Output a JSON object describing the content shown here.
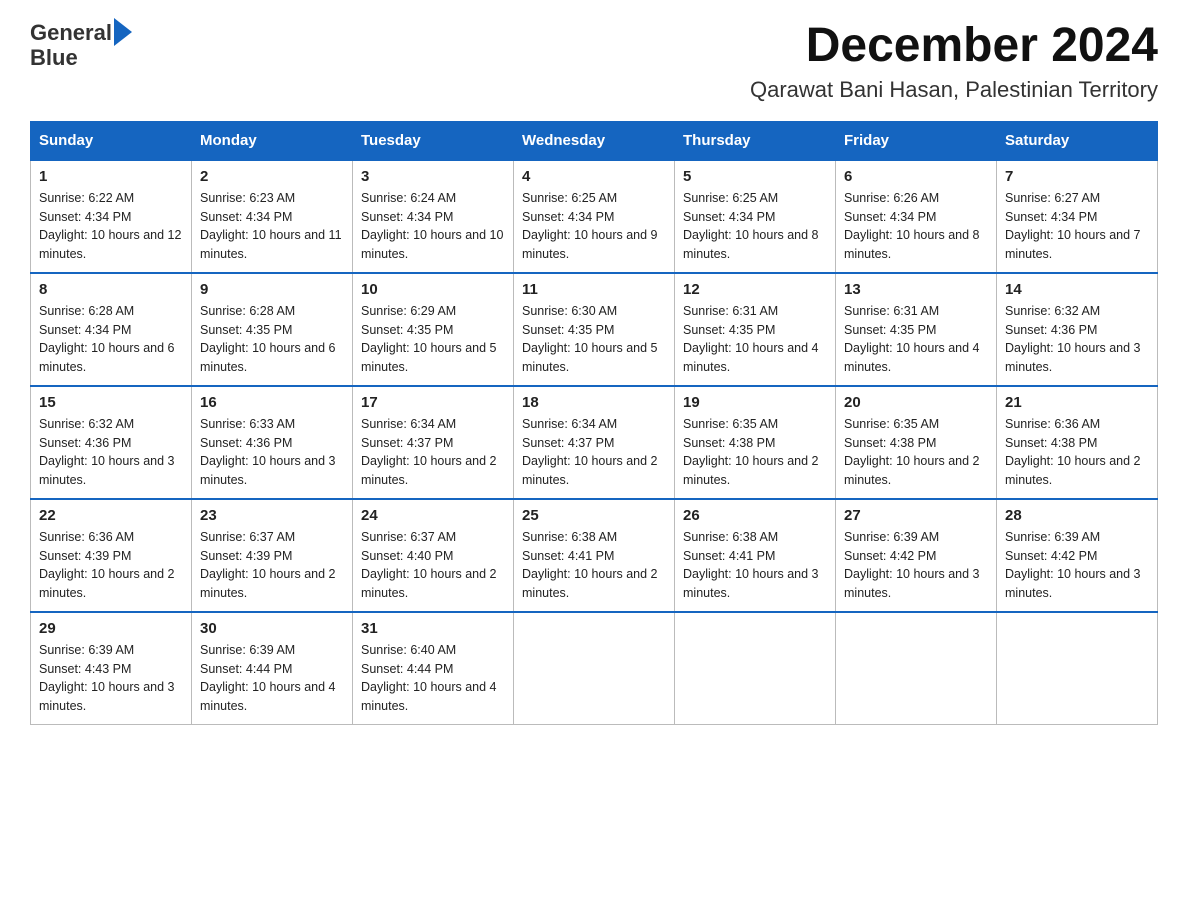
{
  "logo": {
    "text_general": "General",
    "text_blue": "Blue"
  },
  "header": {
    "month_year": "December 2024",
    "location": "Qarawat Bani Hasan, Palestinian Territory"
  },
  "weekdays": [
    "Sunday",
    "Monday",
    "Tuesday",
    "Wednesday",
    "Thursday",
    "Friday",
    "Saturday"
  ],
  "weeks": [
    [
      {
        "day": "1",
        "sunrise": "6:22 AM",
        "sunset": "4:34 PM",
        "daylight": "10 hours and 12 minutes."
      },
      {
        "day": "2",
        "sunrise": "6:23 AM",
        "sunset": "4:34 PM",
        "daylight": "10 hours and 11 minutes."
      },
      {
        "day": "3",
        "sunrise": "6:24 AM",
        "sunset": "4:34 PM",
        "daylight": "10 hours and 10 minutes."
      },
      {
        "day": "4",
        "sunrise": "6:25 AM",
        "sunset": "4:34 PM",
        "daylight": "10 hours and 9 minutes."
      },
      {
        "day": "5",
        "sunrise": "6:25 AM",
        "sunset": "4:34 PM",
        "daylight": "10 hours and 8 minutes."
      },
      {
        "day": "6",
        "sunrise": "6:26 AM",
        "sunset": "4:34 PM",
        "daylight": "10 hours and 8 minutes."
      },
      {
        "day": "7",
        "sunrise": "6:27 AM",
        "sunset": "4:34 PM",
        "daylight": "10 hours and 7 minutes."
      }
    ],
    [
      {
        "day": "8",
        "sunrise": "6:28 AM",
        "sunset": "4:34 PM",
        "daylight": "10 hours and 6 minutes."
      },
      {
        "day": "9",
        "sunrise": "6:28 AM",
        "sunset": "4:35 PM",
        "daylight": "10 hours and 6 minutes."
      },
      {
        "day": "10",
        "sunrise": "6:29 AM",
        "sunset": "4:35 PM",
        "daylight": "10 hours and 5 minutes."
      },
      {
        "day": "11",
        "sunrise": "6:30 AM",
        "sunset": "4:35 PM",
        "daylight": "10 hours and 5 minutes."
      },
      {
        "day": "12",
        "sunrise": "6:31 AM",
        "sunset": "4:35 PM",
        "daylight": "10 hours and 4 minutes."
      },
      {
        "day": "13",
        "sunrise": "6:31 AM",
        "sunset": "4:35 PM",
        "daylight": "10 hours and 4 minutes."
      },
      {
        "day": "14",
        "sunrise": "6:32 AM",
        "sunset": "4:36 PM",
        "daylight": "10 hours and 3 minutes."
      }
    ],
    [
      {
        "day": "15",
        "sunrise": "6:32 AM",
        "sunset": "4:36 PM",
        "daylight": "10 hours and 3 minutes."
      },
      {
        "day": "16",
        "sunrise": "6:33 AM",
        "sunset": "4:36 PM",
        "daylight": "10 hours and 3 minutes."
      },
      {
        "day": "17",
        "sunrise": "6:34 AM",
        "sunset": "4:37 PM",
        "daylight": "10 hours and 2 minutes."
      },
      {
        "day": "18",
        "sunrise": "6:34 AM",
        "sunset": "4:37 PM",
        "daylight": "10 hours and 2 minutes."
      },
      {
        "day": "19",
        "sunrise": "6:35 AM",
        "sunset": "4:38 PM",
        "daylight": "10 hours and 2 minutes."
      },
      {
        "day": "20",
        "sunrise": "6:35 AM",
        "sunset": "4:38 PM",
        "daylight": "10 hours and 2 minutes."
      },
      {
        "day": "21",
        "sunrise": "6:36 AM",
        "sunset": "4:38 PM",
        "daylight": "10 hours and 2 minutes."
      }
    ],
    [
      {
        "day": "22",
        "sunrise": "6:36 AM",
        "sunset": "4:39 PM",
        "daylight": "10 hours and 2 minutes."
      },
      {
        "day": "23",
        "sunrise": "6:37 AM",
        "sunset": "4:39 PM",
        "daylight": "10 hours and 2 minutes."
      },
      {
        "day": "24",
        "sunrise": "6:37 AM",
        "sunset": "4:40 PM",
        "daylight": "10 hours and 2 minutes."
      },
      {
        "day": "25",
        "sunrise": "6:38 AM",
        "sunset": "4:41 PM",
        "daylight": "10 hours and 2 minutes."
      },
      {
        "day": "26",
        "sunrise": "6:38 AM",
        "sunset": "4:41 PM",
        "daylight": "10 hours and 3 minutes."
      },
      {
        "day": "27",
        "sunrise": "6:39 AM",
        "sunset": "4:42 PM",
        "daylight": "10 hours and 3 minutes."
      },
      {
        "day": "28",
        "sunrise": "6:39 AM",
        "sunset": "4:42 PM",
        "daylight": "10 hours and 3 minutes."
      }
    ],
    [
      {
        "day": "29",
        "sunrise": "6:39 AM",
        "sunset": "4:43 PM",
        "daylight": "10 hours and 3 minutes."
      },
      {
        "day": "30",
        "sunrise": "6:39 AM",
        "sunset": "4:44 PM",
        "daylight": "10 hours and 4 minutes."
      },
      {
        "day": "31",
        "sunrise": "6:40 AM",
        "sunset": "4:44 PM",
        "daylight": "10 hours and 4 minutes."
      },
      null,
      null,
      null,
      null
    ]
  ]
}
